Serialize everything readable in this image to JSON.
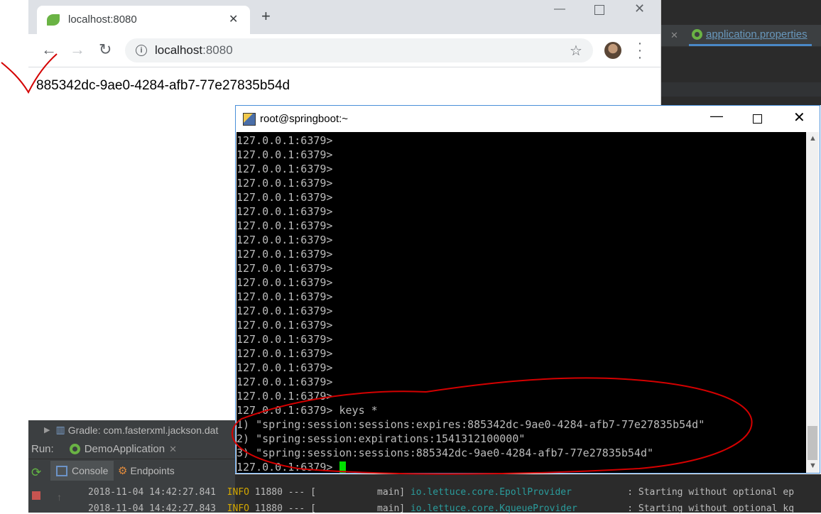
{
  "ide": {
    "tab_label": "application.properties",
    "gradle_label": "Gradle: com.fasterxml.jackson.dat",
    "run_label": "Run:",
    "run_app": "DemoApplication",
    "console_tab": "Console",
    "endpoints_tab": "Endpoints",
    "log": [
      {
        "time": "2018-11-04 14:42:27.841",
        "level": "INFO",
        "rest": " 11880 --- [           main] ",
        "cls": "io.lettuce.core.EpollProvider",
        "msg": "          : Starting without optional ep"
      },
      {
        "time": "2018-11-04 14:42:27.843",
        "level": "INFO",
        "rest": " 11880 --- [           main] ",
        "cls": "io.lettuce.core.KqueueProvider",
        "msg": "         : Starting without optional kq"
      }
    ]
  },
  "browser": {
    "tab_title": "localhost:8080",
    "url_host": "localhost",
    "url_port": ":8080",
    "page_text": "885342dc-9ae0-4284-afb7-77e27835b54d"
  },
  "putty": {
    "title": "root@springboot:~",
    "lines": [
      "127.0.0.1:6379>",
      "127.0.0.1:6379>",
      "127.0.0.1:6379>",
      "127.0.0.1:6379>",
      "127.0.0.1:6379>",
      "127.0.0.1:6379>",
      "127.0.0.1:6379>",
      "127.0.0.1:6379>",
      "127.0.0.1:6379>",
      "127.0.0.1:6379>",
      "127.0.0.1:6379>",
      "127.0.0.1:6379>",
      "127.0.0.1:6379>",
      "127.0.0.1:6379>",
      "127.0.0.1:6379>",
      "127.0.0.1:6379>",
      "127.0.0.1:6379>",
      "127.0.0.1:6379>",
      "127.0.0.1:6379>",
      "127.0.0.1:6379> keys *",
      "1) \"spring:session:sessions:expires:885342dc-9ae0-4284-afb7-77e27835b54d\"",
      "2) \"spring:session:expirations:1541312100000\"",
      "3) \"spring:session:sessions:885342dc-9ae0-4284-afb7-77e27835b54d\""
    ],
    "prompt": "127.0.0.1:6379> "
  },
  "colors": {
    "annotation": "#d40000",
    "cursor": "#00e000",
    "spring_green": "#6ab344"
  }
}
